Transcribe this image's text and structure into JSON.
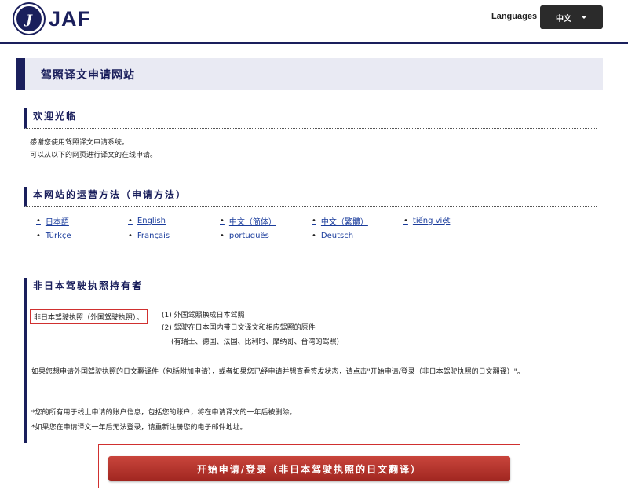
{
  "header": {
    "brand": "JAF",
    "logo_mark": "JAF",
    "languages_label": "Languages :",
    "language_selected": "中文"
  },
  "page_title": "驾照译文申请网站",
  "welcome": {
    "heading": "欢迎光临",
    "line1": "感谢您使用驾照译文申请系统。",
    "line2": "可以从以下的网页进行译文的在线申请。"
  },
  "howto": {
    "heading": "本网站的运营方法（申请方法）",
    "languages": [
      "日本語",
      "English",
      "中文（简体）",
      "中文（繁體）",
      "tiếng việt",
      "Türkçe",
      "Français",
      "português",
      "Deutsch"
    ]
  },
  "nonjp": {
    "heading": "非日本驾驶执照持有者",
    "boxed_label": "非日本驾驶执照（外国驾驶执照）。",
    "item1": "(1) 外国驾照换成日本驾照",
    "item2": "(2) 驾驶在日本国内带日文译文和相应驾照的原件",
    "item2_note": "(有瑞士、德国、法国、比利时、摩纳哥、台湾的驾照)",
    "para": "如果您想申请外国驾驶执照的日文翻译件（包括附加申请），或者如果您已经申请并想查看签发状态，请点击\"开始申请/登录（非日本驾驶执照的日文翻译）\"。",
    "note1": "*您的所有用于线上申请的账户信息，包括您的账户，将在申请译文的一年后被删除。",
    "note2": "*如果您在申请译文一年后无法登录，请重新注册您的电子邮件地址。"
  },
  "start_button": "开始申请/登录（非日本驾驶执照的日文翻译）"
}
